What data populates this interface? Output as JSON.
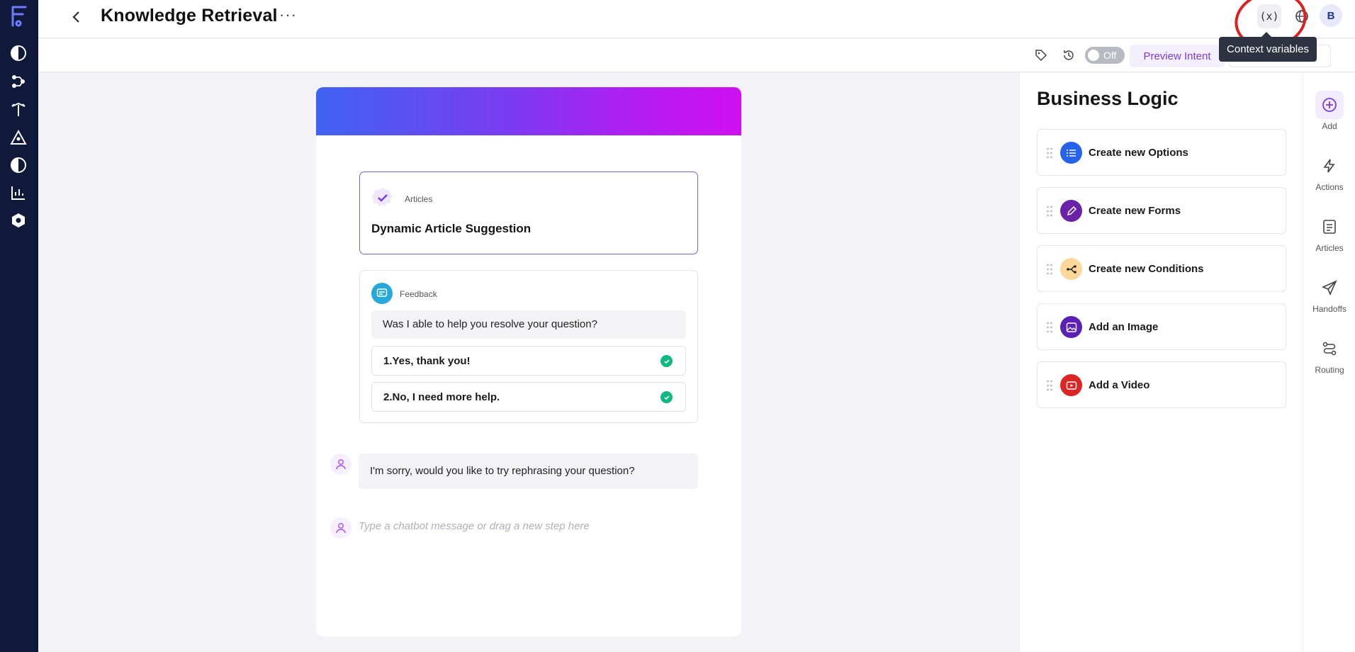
{
  "header": {
    "title": "Knowledge Retrieval",
    "more": "···",
    "context_button": "(x)",
    "avatar_initial": "B",
    "tooltip": "Context variables"
  },
  "toolbar": {
    "toggle_label": "Off",
    "preview_label": "Preview Intent"
  },
  "canvas": {
    "articles_step": {
      "tag": "Articles",
      "title": "Dynamic Article Suggestion"
    },
    "feedback_step": {
      "tag": "Feedback",
      "question": "Was I able to help you resolve your question?",
      "options": [
        "1.Yes, thank you!",
        "2.No, I need more help."
      ]
    },
    "bot_message": "I'm sorry, would you like to try rephrasing your question?",
    "input_placeholder": "Type a chatbot message or drag a new step here"
  },
  "business_logic": {
    "title": "Business Logic",
    "items": [
      {
        "label": "Create new Options",
        "icon": "list-icon",
        "color": "#2563eb"
      },
      {
        "label": "Create new Forms",
        "icon": "pencil-icon",
        "color": "#6b21a8"
      },
      {
        "label": "Create new Conditions",
        "icon": "branch-icon",
        "color": "#fcd79a"
      },
      {
        "label": "Add an Image",
        "icon": "image-icon",
        "color": "#5b21b6"
      },
      {
        "label": "Add a Video",
        "icon": "video-icon",
        "color": "#dc2626"
      }
    ]
  },
  "right_nav": [
    {
      "label": "Add",
      "icon": "plus-circle-icon"
    },
    {
      "label": "Actions",
      "icon": "lightning-icon"
    },
    {
      "label": "Articles",
      "icon": "document-icon"
    },
    {
      "label": "Handoffs",
      "icon": "send-icon"
    },
    {
      "label": "Routing",
      "icon": "route-icon"
    }
  ],
  "colors": {
    "rail": "#0f1a3a",
    "accent": "#7c3aed",
    "success": "#10b981"
  }
}
